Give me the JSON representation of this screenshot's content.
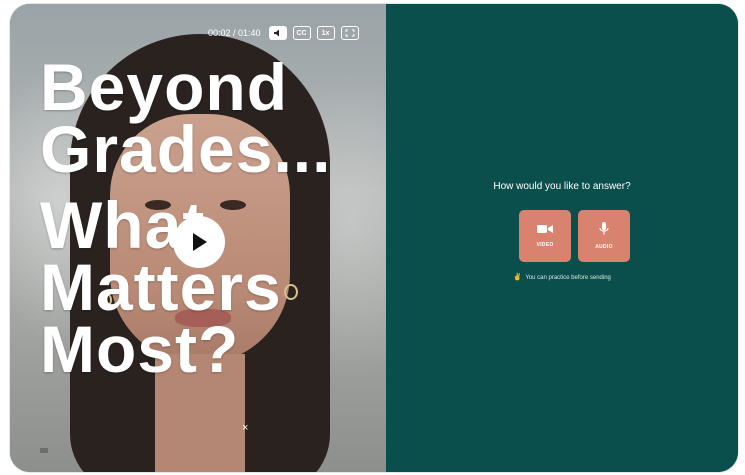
{
  "player": {
    "time": "00:02 / 01:40",
    "cc_label": "CC",
    "speed_label": "1x",
    "headline": {
      "line1": "Beyond",
      "line2": "Grades...",
      "line3": "What",
      "line4": "Matters",
      "line5": "Most?"
    },
    "close_glyph": "×"
  },
  "answer": {
    "question": "How would you like to answer?",
    "buttons": {
      "video_label": "VIDEO",
      "audio_label": "AUDIO"
    },
    "hint_text": "You can practice before sending"
  },
  "colors": {
    "panel_bg": "#0b4f4c",
    "button_bg": "#d8826f"
  },
  "icons": [
    "volume-icon",
    "closed-captions-icon",
    "fullscreen-icon",
    "play-icon",
    "video-camera-icon",
    "microphone-icon",
    "hand-icon",
    "close-icon"
  ]
}
